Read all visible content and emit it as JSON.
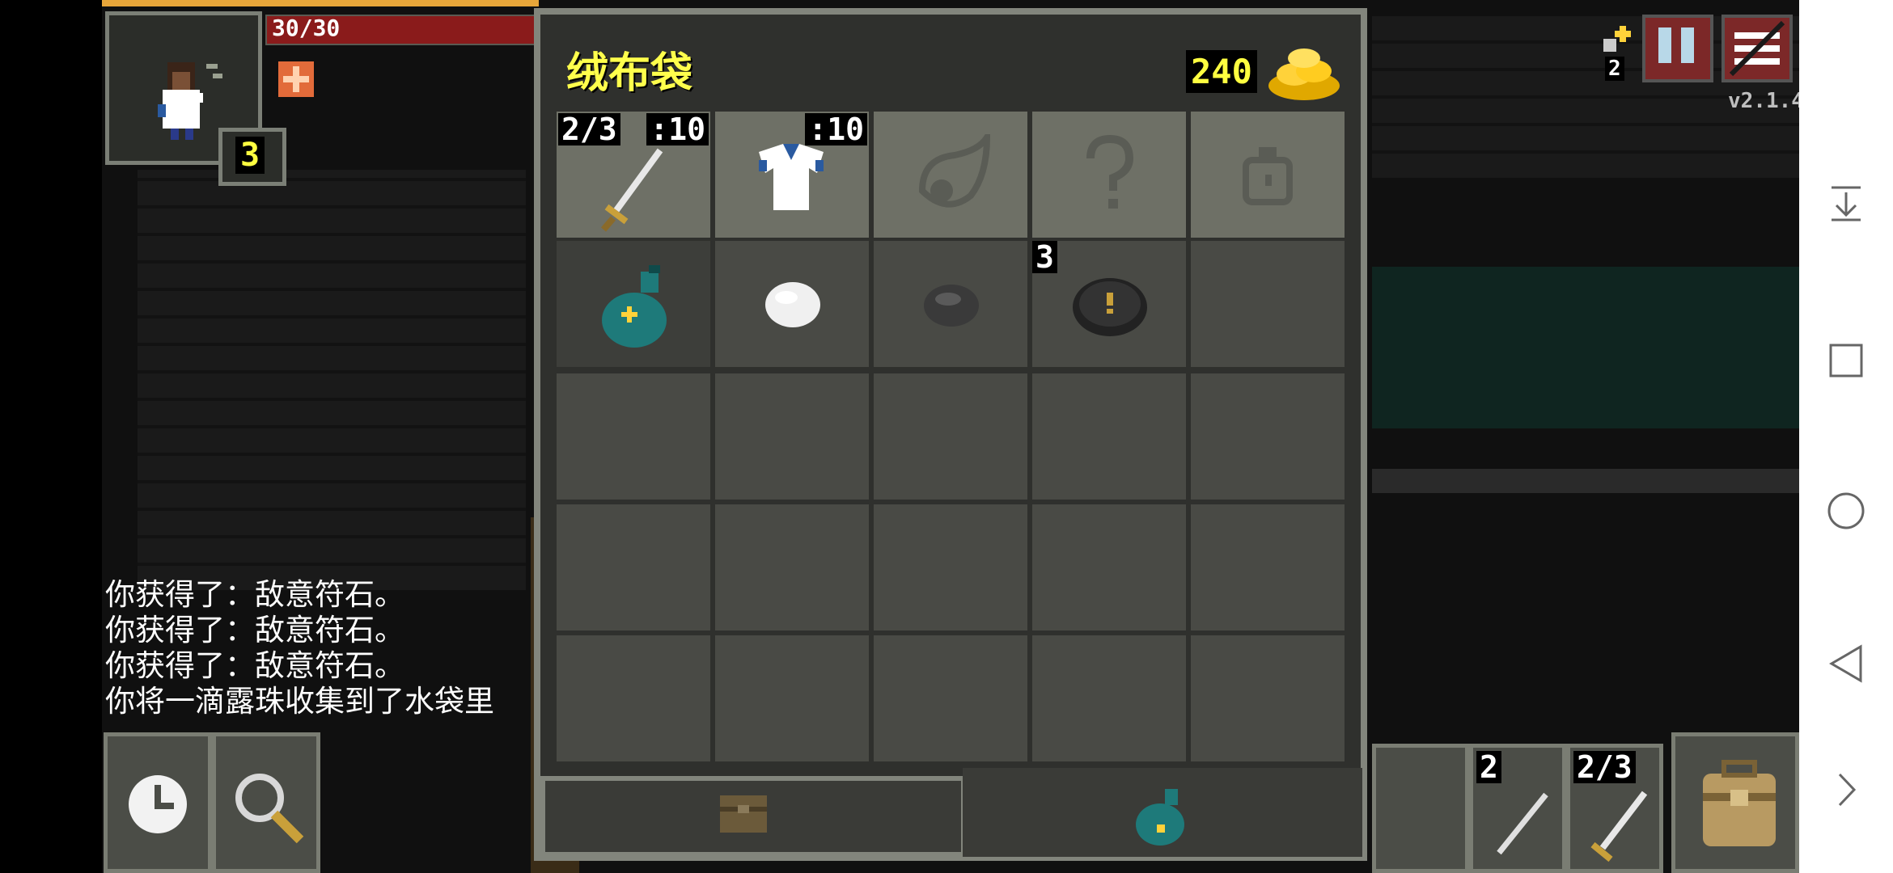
{
  "hud": {
    "hp": "30/30",
    "hero_level": "3",
    "version": "v2.1.4",
    "journal_count": "2"
  },
  "log": [
    "你获得了：敌意符石。",
    "你获得了：敌意符石。",
    "你获得了：敌意符石。",
    "你将一滴露珠收集到了水袋里"
  ],
  "bag": {
    "title": "绒布袋",
    "gold": "240",
    "equip_slots": [
      {
        "item": "sword",
        "badge_left": "2/3",
        "badge_right": ":10"
      },
      {
        "item": "cloth-armor",
        "badge_left": "",
        "badge_right": ":10"
      },
      {
        "item": "artifact-placeholder",
        "badge_left": "",
        "badge_right": ""
      },
      {
        "item": "misc-placeholder",
        "badge_left": "",
        "badge_right": ""
      },
      {
        "item": "ring-placeholder",
        "badge_left": "",
        "badge_right": ""
      }
    ],
    "items": [
      {
        "item": "waterskin",
        "count": ""
      },
      {
        "item": "white-stone",
        "count": ""
      },
      {
        "item": "grey-stone",
        "count": ""
      },
      {
        "item": "runestone-hostility",
        "count": "3"
      }
    ]
  },
  "quickslots": [
    {
      "count": "2",
      "icon": "dart-icon"
    },
    {
      "count": "2/3",
      "icon": "sword-icon"
    }
  ],
  "colors": {
    "title_yellow": "#ffff4c",
    "hp_red": "#8a1b1b",
    "panel": "#2f302d",
    "frame": "#82857c"
  }
}
